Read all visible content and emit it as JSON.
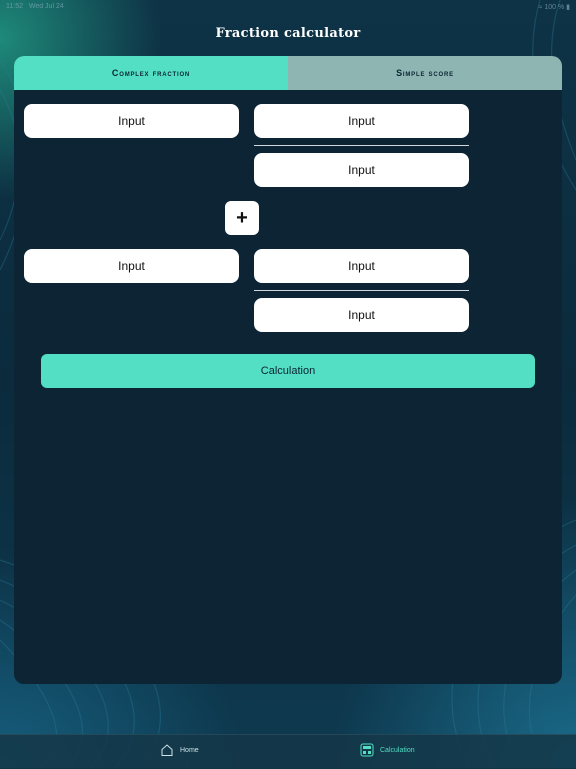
{
  "status_bar": {
    "time": "11:52",
    "date": "Wed Jul 24",
    "battery": "100 %"
  },
  "app": {
    "title": "Fraction calculator"
  },
  "tabs": [
    {
      "label": "Complex fraction",
      "active": true
    },
    {
      "label": "Simple score",
      "active": false
    }
  ],
  "first_fraction": {
    "whole_placeholder": "Input",
    "numerator_placeholder": "Input",
    "denominator_placeholder": "Input"
  },
  "operator": {
    "symbol": "+"
  },
  "second_fraction": {
    "whole_placeholder": "Input",
    "numerator_placeholder": "Input",
    "denominator_placeholder": "Input"
  },
  "calculate_button": {
    "label": "Calculation"
  },
  "bottom_nav": {
    "items": [
      {
        "label": "Home",
        "icon": "home-icon",
        "active": false
      },
      {
        "label": "Calculation",
        "icon": "calculator-icon",
        "active": true
      }
    ]
  },
  "colors": {
    "accent": "#52dfc4",
    "inactive_tab": "#8fb5b3",
    "panel": "#0c2433",
    "field": "#ffffff"
  }
}
